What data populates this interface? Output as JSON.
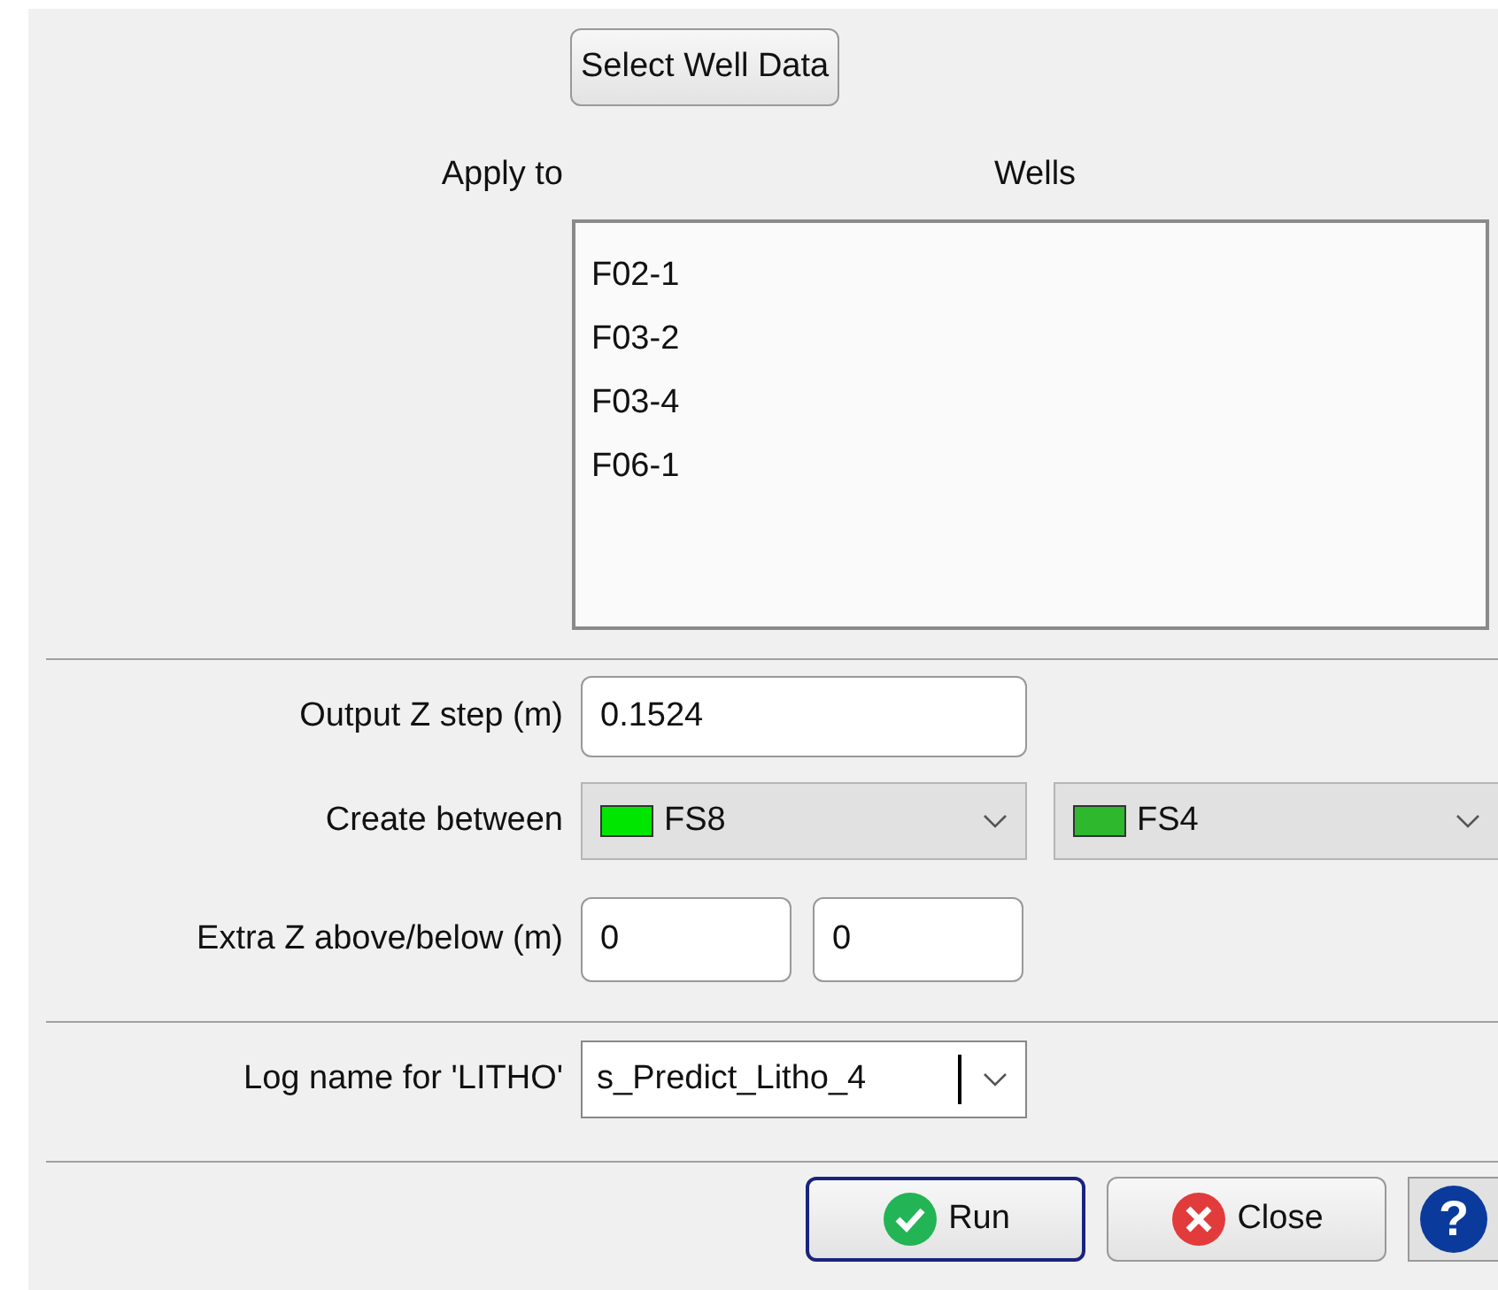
{
  "select_button": "Select Well Data",
  "apply_to": {
    "label": "Apply to",
    "header": "Wells",
    "items": [
      "F02-1",
      "F03-2",
      "F03-4",
      "F06-1"
    ]
  },
  "z_step": {
    "label": "Output Z step (m)",
    "value": "0.1524"
  },
  "create_between": {
    "label": "Create between",
    "horizons": [
      {
        "name": "FS8",
        "color": "#00e600"
      },
      {
        "name": "FS4",
        "color": "#2db82d"
      }
    ]
  },
  "extra_z": {
    "label": "Extra Z above/below (m)",
    "values": [
      "0",
      "0"
    ]
  },
  "log_name": {
    "label": "Log name for 'LITHO'",
    "value": "s_Predict_Litho_4"
  },
  "buttons": [
    {
      "kind": "run",
      "label": "Run"
    },
    {
      "kind": "close",
      "label": "Close"
    },
    {
      "kind": "help",
      "label": "?"
    }
  ]
}
